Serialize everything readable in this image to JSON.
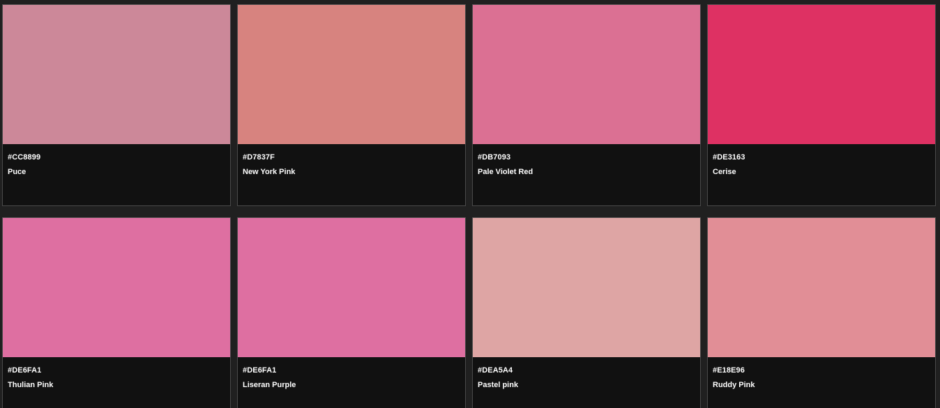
{
  "colors": [
    {
      "hex": "#CC8899",
      "name": "Puce",
      "swatch": "#CC8899"
    },
    {
      "hex": "#D7837F",
      "name": "New York Pink",
      "swatch": "#D7837F"
    },
    {
      "hex": "#DB7093",
      "name": "Pale Violet Red",
      "swatch": "#DB7093"
    },
    {
      "hex": "#DE3163",
      "name": "Cerise",
      "swatch": "#DE3163"
    },
    {
      "hex": "#DE6FA1",
      "name": "Thulian Pink",
      "swatch": "#DE6FA1"
    },
    {
      "hex": "#DE6FA1",
      "name": "Liseran Purple",
      "swatch": "#DE6FA1"
    },
    {
      "hex": "#DEA5A4",
      "name": "Pastel pink",
      "swatch": "#DEA5A4"
    },
    {
      "hex": "#E18E96",
      "name": "Ruddy Pink",
      "swatch": "#E18E96"
    }
  ],
  "theme": {
    "background": "#202020",
    "card_background": "#111111",
    "text": "#FFFFFF"
  }
}
